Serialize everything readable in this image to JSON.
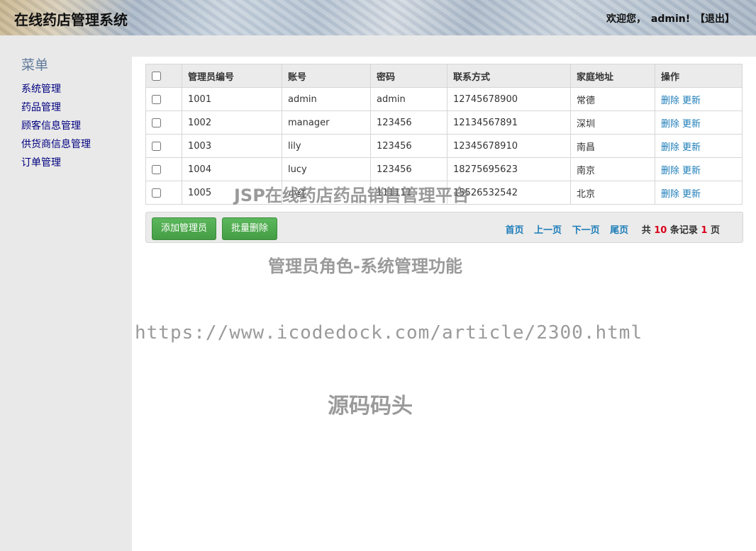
{
  "header": {
    "title": "在线药店管理系统",
    "welcome_prefix": "欢迎您，",
    "username": "admin!",
    "logout": "【退出】"
  },
  "sidebar": {
    "title": "菜单",
    "items": [
      {
        "label": "系统管理"
      },
      {
        "label": "药品管理"
      },
      {
        "label": "顾客信息管理"
      },
      {
        "label": "供货商信息管理"
      },
      {
        "label": "订单管理"
      }
    ]
  },
  "table": {
    "columns": [
      "管理员编号",
      "账号",
      "密码",
      "联系方式",
      "家庭地址",
      "操作"
    ],
    "rows": [
      {
        "id": "1001",
        "account": "admin",
        "password": "admin",
        "phone": "12745678900",
        "address": "常德"
      },
      {
        "id": "1002",
        "account": "manager",
        "password": "123456",
        "phone": "12134567891",
        "address": "深圳"
      },
      {
        "id": "1003",
        "account": "lily",
        "password": "123456",
        "phone": "12345678910",
        "address": "南昌"
      },
      {
        "id": "1004",
        "account": "lucy",
        "password": "123456",
        "phone": "18275695623",
        "address": "南京"
      },
      {
        "id": "1005",
        "account": "小红",
        "password": "111111",
        "phone": "15526532542",
        "address": "北京"
      }
    ],
    "op_delete": "删除",
    "op_update": "更新"
  },
  "toolbar": {
    "add_label": "添加管理员",
    "batch_delete_label": "批量删除"
  },
  "pager": {
    "first": "首页",
    "prev": "上一页",
    "next": "下一页",
    "last": "尾页",
    "total_prefix": "共",
    "total_records": "10",
    "records_suffix": "条记录",
    "total_pages": "1",
    "pages_suffix": "页"
  },
  "watermarks": {
    "line1": "JSP在线药店药品销售管理平台",
    "line2": "管理员角色-系统管理功能",
    "line3": "https://www.icodedock.com/article/2300.html",
    "line4": "源码码头"
  },
  "colors": {
    "link": "#1c7cb8",
    "button": "#5cb85c",
    "count_highlight": "#d9001b",
    "menu_link": "#000080"
  }
}
